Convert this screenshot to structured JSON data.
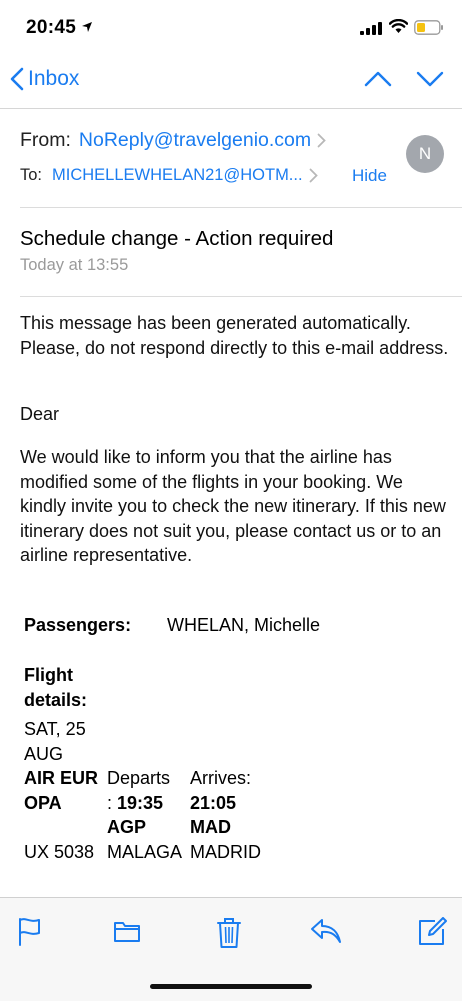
{
  "status": {
    "time": "20:45"
  },
  "nav": {
    "back_label": "Inbox"
  },
  "header": {
    "from_label": "From:",
    "from_address": "NoReply@travelgenio.com",
    "to_label": "To:",
    "to_address": "MICHELLEWHELAN21@HOTM...",
    "hide_label": "Hide",
    "avatar_initial": "N",
    "subject": "Schedule change - Action required",
    "date": "Today at 13:55"
  },
  "body": {
    "p1": "This message has been generated automatically. Please, do not respond directly to this e-mail address.",
    "p2": "Dear",
    "p3": "We would like to inform you that the airline has modified some of the flights in your booking. We kindly invite you to check the new itinerary. If this new itinerary does not suit you, please contact us or to an airline representative.",
    "passengers_label": "Passengers:",
    "passengers_value": "WHELAN, Michelle",
    "flight_details_label": "Flight details:",
    "flight": {
      "date": "SAT, 25 AUG",
      "airline": "AIR EUROPA",
      "flight_no": "UX 5038",
      "departs_label": "Departs",
      "departs_prefix": ": ",
      "departs_time": "19:35",
      "departs_code": "AGP",
      "departs_city": "MALAGA",
      "arrives_label": "Arrives:",
      "arrives_time": "21:05",
      "arrives_code": "MAD",
      "arrives_city": "MADRID"
    }
  },
  "colors": {
    "accent": "#1a7cf0",
    "avatar_bg": "#a3a7ad",
    "muted": "#9a9a9a"
  },
  "toolbar_icons": [
    "flag-icon",
    "folder-icon",
    "trash-icon",
    "reply-icon",
    "compose-icon"
  ]
}
